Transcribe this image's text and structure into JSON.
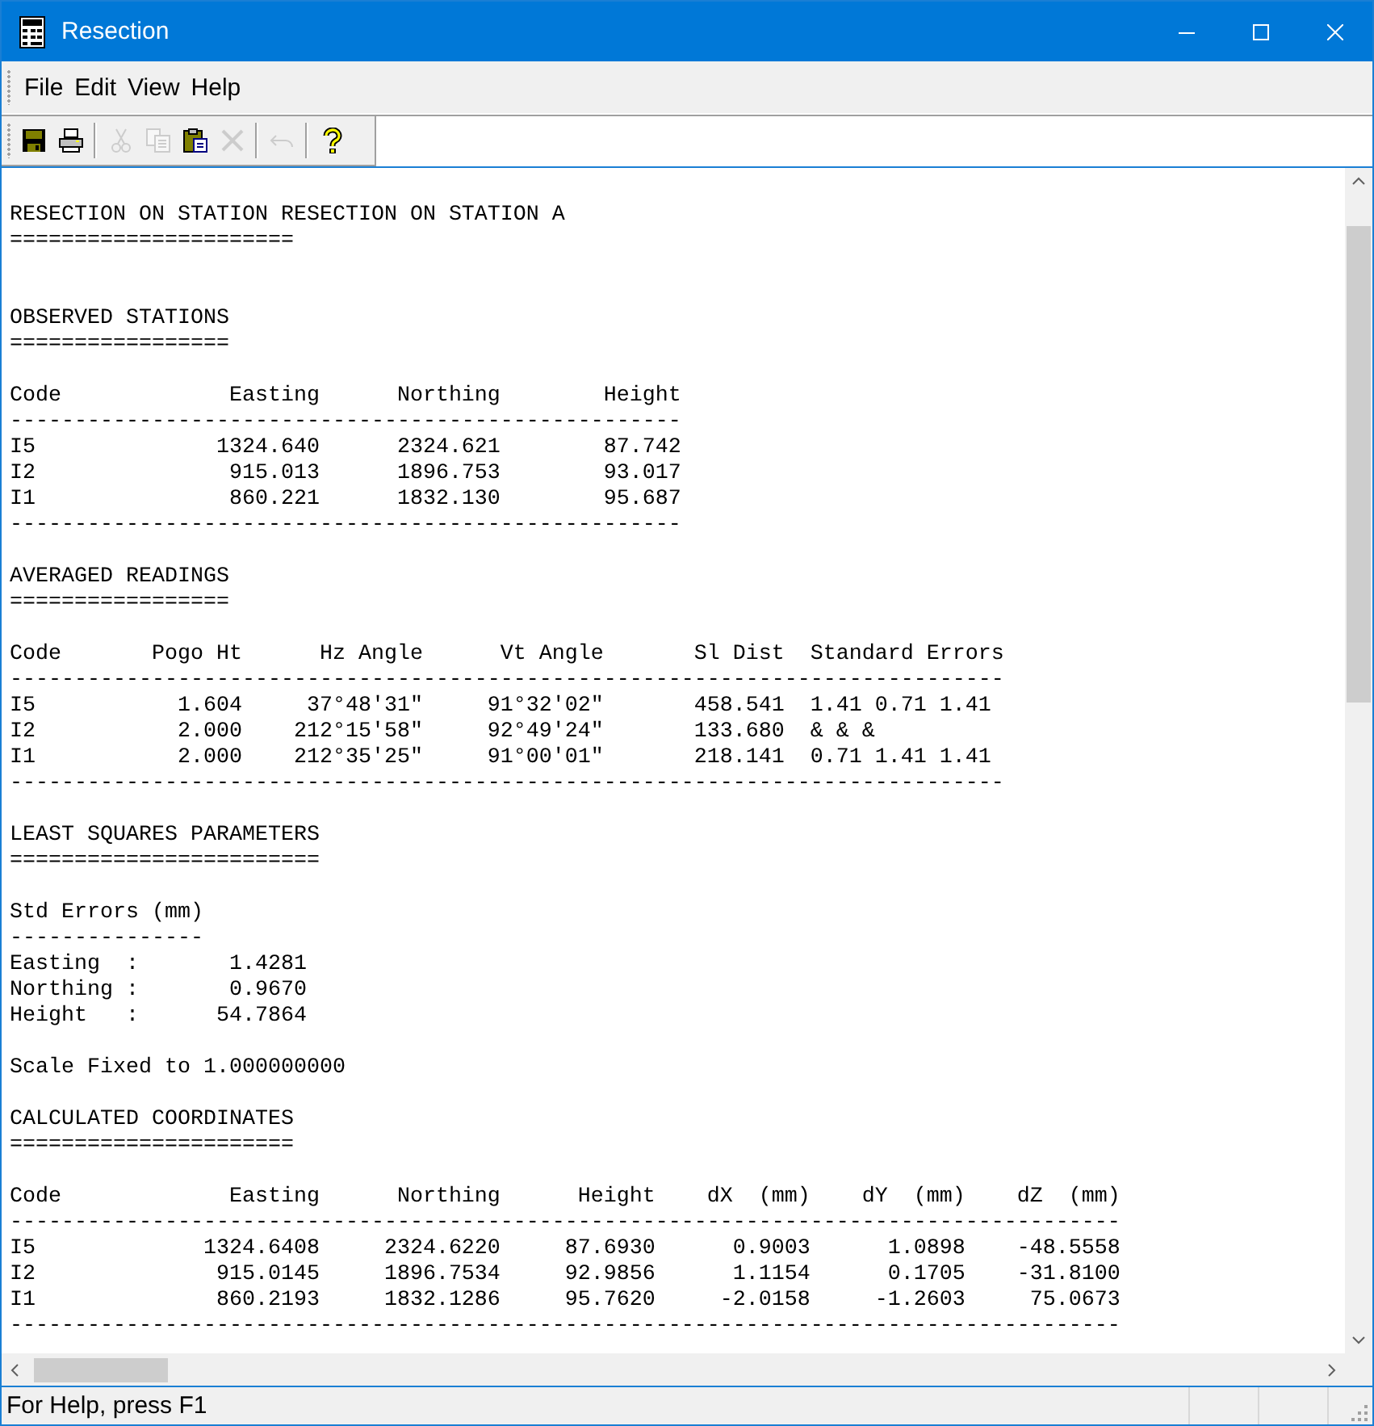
{
  "window": {
    "title": "Resection"
  },
  "menu": [
    "File",
    "Edit",
    "View",
    "Help"
  ],
  "toolbar": [
    {
      "kind": "save",
      "disabled": false
    },
    {
      "kind": "print",
      "disabled": false
    },
    {
      "kind": "separator"
    },
    {
      "kind": "cut",
      "disabled": true
    },
    {
      "kind": "copy",
      "disabled": true
    },
    {
      "kind": "paste",
      "disabled": false
    },
    {
      "kind": "delete",
      "disabled": true
    },
    {
      "kind": "separator"
    },
    {
      "kind": "undo",
      "disabled": true
    },
    {
      "kind": "separator"
    },
    {
      "kind": "help",
      "disabled": false
    }
  ],
  "report": {
    "lines": [
      {
        "kind": "text",
        "text": "RESECTION ON STATION RESECTION ON STATION A"
      },
      {
        "kind": "text",
        "text": "======================"
      },
      {
        "kind": "blank"
      },
      {
        "kind": "blank"
      },
      {
        "kind": "text",
        "text": "OBSERVED STATIONS"
      },
      {
        "kind": "text",
        "text": "================="
      },
      {
        "kind": "blank"
      },
      {
        "kind": "text",
        "text": "Code             Easting      Northing        Height"
      },
      {
        "kind": "text",
        "text": "----------------------------------------------------"
      },
      {
        "kind": "text",
        "text": "I5              1324.640      2324.621        87.742"
      },
      {
        "kind": "text",
        "text": "I2               915.013      1896.753        93.017"
      },
      {
        "kind": "text",
        "text": "I1               860.221      1832.130        95.687"
      },
      {
        "kind": "text",
        "text": "----------------------------------------------------"
      },
      {
        "kind": "blank"
      },
      {
        "kind": "text",
        "text": "AVERAGED READINGS"
      },
      {
        "kind": "text",
        "text": "================="
      },
      {
        "kind": "blank"
      },
      {
        "kind": "text",
        "text": "Code       Pogo Ht      Hz Angle      Vt Angle       Sl Dist  Standard Errors"
      },
      {
        "kind": "text",
        "text": "-----------------------------------------------------------------------------"
      },
      {
        "kind": "text",
        "text": "I5           1.604     37°48'31\"     91°32'02\"       458.541  1.41 0.71 1.41"
      },
      {
        "kind": "text",
        "text": "I2           2.000    212°15'58\"     92°49'24\"       133.680  & & &"
      },
      {
        "kind": "text",
        "text": "I1           2.000    212°35'25\"     91°00'01\"       218.141  0.71 1.41 1.41"
      },
      {
        "kind": "text",
        "text": "-----------------------------------------------------------------------------"
      },
      {
        "kind": "blank"
      },
      {
        "kind": "text",
        "text": "LEAST SQUARES PARAMETERS"
      },
      {
        "kind": "text",
        "text": "========================"
      },
      {
        "kind": "blank"
      },
      {
        "kind": "text",
        "text": "Std Errors (mm)"
      },
      {
        "kind": "text",
        "text": "---------------"
      },
      {
        "kind": "text",
        "text": "Easting  :       1.4281"
      },
      {
        "kind": "text",
        "text": "Northing :       0.9670"
      },
      {
        "kind": "text",
        "text": "Height   :      54.7864"
      },
      {
        "kind": "blank"
      },
      {
        "kind": "text",
        "text": "Scale Fixed to 1.000000000"
      },
      {
        "kind": "blank"
      },
      {
        "kind": "text",
        "text": "CALCULATED COORDINATES"
      },
      {
        "kind": "text",
        "text": "======================"
      },
      {
        "kind": "blank"
      },
      {
        "kind": "text",
        "text": "Code             Easting      Northing      Height    dX  (mm)    dY  (mm)    dZ  (mm)"
      },
      {
        "kind": "text",
        "text": "--------------------------------------------------------------------------------------"
      },
      {
        "kind": "text",
        "text": "I5             1324.6408     2324.6220     87.6930      0.9003      1.0898    -48.5558"
      },
      {
        "kind": "text",
        "text": "I2              915.0145     1896.7534     92.9856      1.1154      0.1705    -31.8100"
      },
      {
        "kind": "text",
        "text": "I1              860.2193     1832.1286     95.7620     -2.0158     -1.2603     75.0673"
      },
      {
        "kind": "text",
        "text": "--------------------------------------------------------------------------------------"
      }
    ]
  },
  "status_bar": {
    "text": "For Help, press F1"
  }
}
